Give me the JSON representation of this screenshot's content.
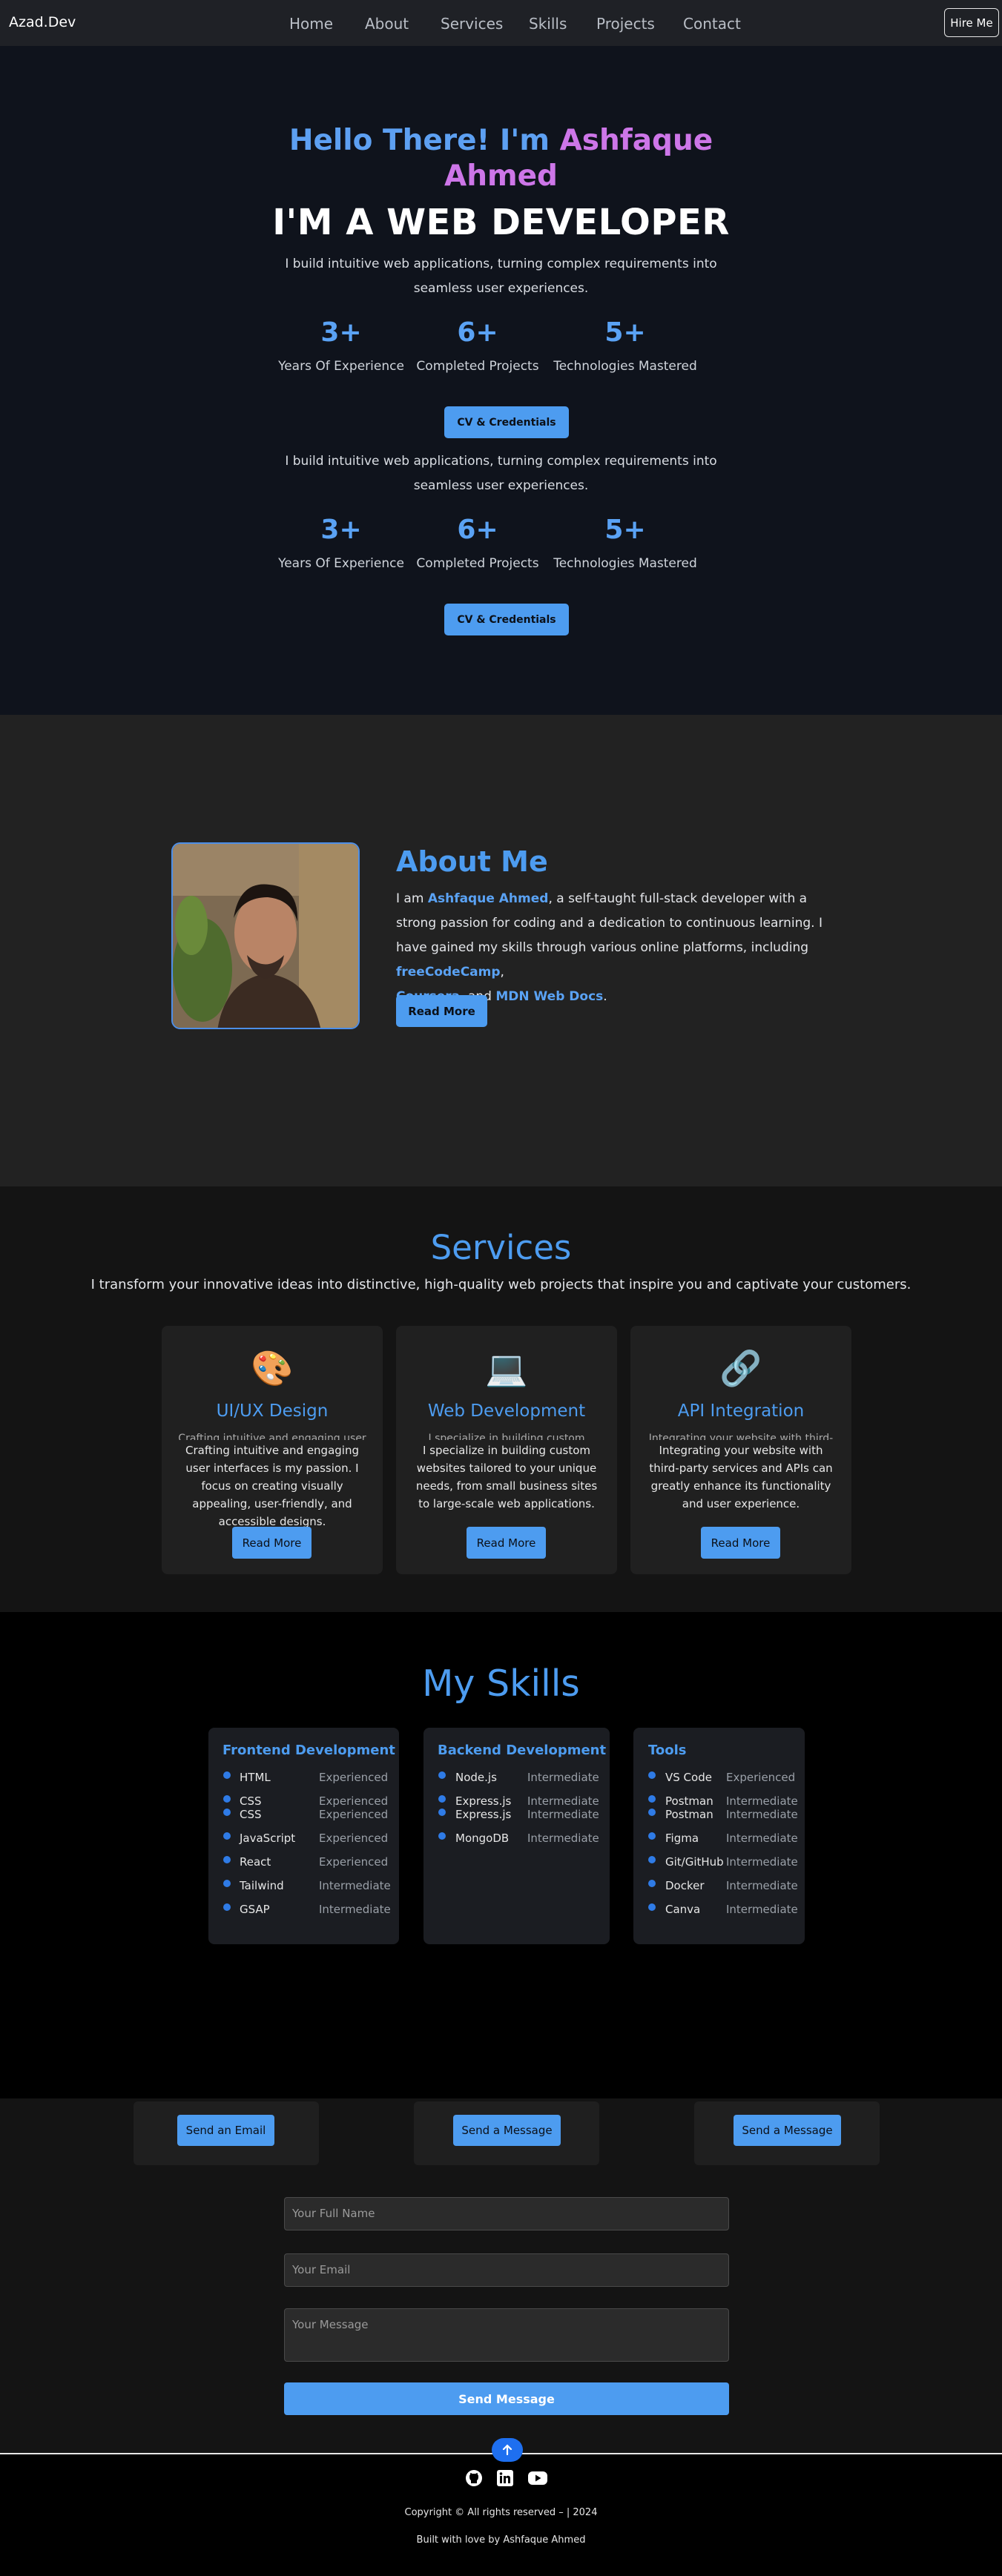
{
  "nav": {
    "brand": "Azad.Dev",
    "links": [
      "Home",
      "About",
      "Services",
      "Skills",
      "Projects",
      "Contact"
    ],
    "hire": "Hire Me"
  },
  "hero": {
    "hello_a": "Hello There! I'm ",
    "hello_b": "Ashfaque",
    "hello_c": "Ahmed",
    "role": "I'M A WEB DEVELOPER",
    "intro_1": "I build intuitive web applications, turning complex requirements into",
    "intro_2": "seamless user experiences.",
    "stats": [
      {
        "value": "3+",
        "label": "Years Of Experience"
      },
      {
        "value": "6+",
        "label": "Completed Projects"
      },
      {
        "value": "5+",
        "label": "Technologies Mastered"
      }
    ],
    "cv": "CV & Credentials"
  },
  "about": {
    "title": "About Me",
    "p1": "I am ",
    "name": "Ashfaque Ahmed",
    "p2": ", a self-taught full-stack developer with a strong passion for coding and a dedication to continuous learning. I have gained my skills through various online platforms, including ",
    "fcc": "freeCodeCamp",
    "comma": ",",
    "coursera": "Coursera",
    "and": ", and ",
    "mdn": "MDN Web Docs",
    "dot": ".",
    "read_more": "Read More"
  },
  "services": {
    "title": "Services",
    "subtitle": "I transform your innovative ideas into distinctive, high-quality web projects that inspire you and captivate your customers.",
    "items": [
      {
        "icon": "🎨",
        "name": "UI/UX Design",
        "ghost": "Crafting intuitive and engaging user",
        "desc": "Crafting intuitive and engaging user interfaces is my passion. I focus on creating visually appealing, user-friendly, and accessible designs.",
        "btn": "Read More"
      },
      {
        "icon": "💻",
        "name": "Web Development",
        "ghost": "I specialize in building custom",
        "desc": "I specialize in building custom websites tailored to your unique needs, from small business sites to large-scale web applications.",
        "btn": "Read More"
      },
      {
        "icon": "🔗",
        "name": "API Integration",
        "ghost": "Integrating your website with third-",
        "desc": "Integrating your website with third-party services and APIs can greatly enhance its functionality and user experience.",
        "btn": "Read More"
      }
    ]
  },
  "skills": {
    "title": "My Skills",
    "groups": [
      {
        "name": "Frontend Development",
        "items": [
          {
            "n": "HTML",
            "l": "Experienced"
          },
          {
            "n": "CSS",
            "l": "Experienced"
          },
          {
            "n": "CSS",
            "l": "Experienced"
          },
          {
            "n": "JavaScript",
            "l": "Experienced"
          },
          {
            "n": "React",
            "l": "Experienced"
          },
          {
            "n": "Tailwind",
            "l": "Intermediate"
          },
          {
            "n": "GSAP",
            "l": "Intermediate"
          }
        ]
      },
      {
        "name": "Backend Development",
        "items": [
          {
            "n": "Node.js",
            "l": "Intermediate"
          },
          {
            "n": "Express.js",
            "l": "Intermediate"
          },
          {
            "n": "Express.js",
            "l": "Intermediate"
          },
          {
            "n": "MongoDB",
            "l": "Intermediate"
          }
        ]
      },
      {
        "name": "Tools",
        "items": [
          {
            "n": "VS Code",
            "l": "Experienced"
          },
          {
            "n": "Postman",
            "l": "Intermediate"
          },
          {
            "n": "Postman",
            "l": "Intermediate"
          },
          {
            "n": "Figma",
            "l": "Intermediate"
          },
          {
            "n": "Git/GitHub",
            "l": "Intermediate"
          },
          {
            "n": "Docker",
            "l": "Intermediate"
          },
          {
            "n": "Canva",
            "l": "Intermediate"
          }
        ]
      }
    ]
  },
  "contact": {
    "buttons": [
      "Send an Email",
      "Send a Message",
      "Send a Message"
    ],
    "name_ph": "Your Full Name",
    "email_ph": "Your Email",
    "msg_ph": "Your Message",
    "send": "Send Message"
  },
  "footer": {
    "copyright": "Copyright © All rights reserved – | 2024",
    "built": "Built with love by Ashfaque Ahmed",
    "icons": [
      "github-icon",
      "linkedin-icon",
      "youtube-icon"
    ]
  }
}
